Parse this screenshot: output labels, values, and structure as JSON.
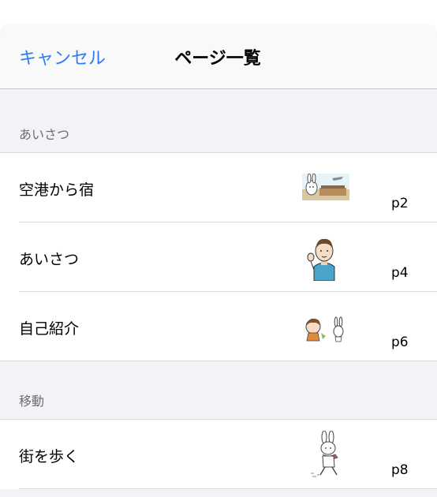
{
  "nav": {
    "cancel_label": "キャンセル",
    "title": "ページ一覧"
  },
  "sections": [
    {
      "header": "あいさつ",
      "rows": [
        {
          "label": "空港から宿",
          "page": "p2",
          "thumb": "bunny-airport-illustration"
        },
        {
          "label": "あいさつ",
          "page": "p4",
          "thumb": "waving-staff-illustration"
        },
        {
          "label": "自己紹介",
          "page": "p6",
          "thumb": "girl-and-bunny-illustration"
        }
      ]
    },
    {
      "header": "移動",
      "rows": [
        {
          "label": "街を歩く",
          "page": "p8",
          "thumb": "walking-bunny-illustration"
        }
      ]
    }
  ],
  "colors": {
    "accent": "#2f7df6",
    "grouped_background": "#f2f2f7",
    "section_header_text": "#6d6d72"
  }
}
